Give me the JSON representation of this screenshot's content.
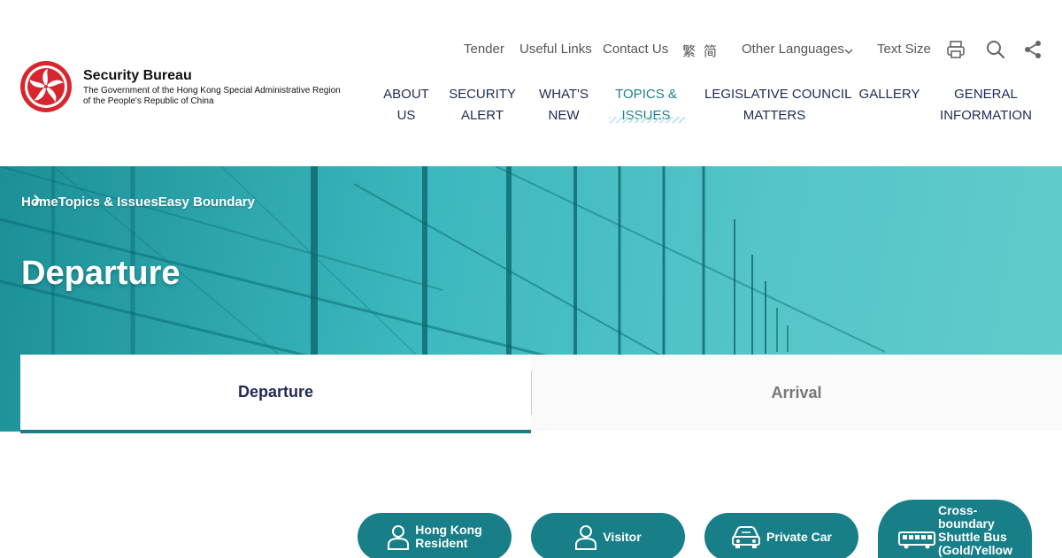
{
  "org": {
    "title": "Security Bureau",
    "subtitle_line1": "The Government of the Hong Kong Special Administrative Region",
    "subtitle_line2": "of the People's Republic of China"
  },
  "utility": {
    "tender": "Tender",
    "useful_links": "Useful Links",
    "contact_us": "Contact Us",
    "lang_tc": "繁",
    "lang_sc": "简",
    "other_languages": "Other Languages",
    "text_size": "Text Size",
    "icons": [
      "print-icon",
      "search-icon",
      "share-icon"
    ]
  },
  "nav": {
    "items": [
      {
        "line1": "ABOUT",
        "line2": "US"
      },
      {
        "line1": "SECURITY",
        "line2": "ALERT"
      },
      {
        "line1": "WHAT'S",
        "line2": "NEW"
      },
      {
        "line1": "TOPICS &",
        "line2": "ISSUES"
      },
      {
        "line1": "LEGISLATIVE COUNCIL",
        "line2": "MATTERS"
      },
      {
        "line1": "GALLERY",
        "line2": ""
      },
      {
        "line1": "GENERAL",
        "line2": "INFORMATION"
      }
    ],
    "active_index": 3
  },
  "breadcrumb": [
    "Home",
    "Topics & Issues",
    "Easy Boundary"
  ],
  "page_title": "Departure",
  "tabs": [
    "Departure",
    "Arrival"
  ],
  "categories": [
    {
      "line1": "Hong Kong",
      "line2": "Resident",
      "icon": "person-icon"
    },
    {
      "line1": "Visitor",
      "line2": "",
      "icon": "person-icon"
    },
    {
      "line1": "Private Car",
      "line2": "",
      "icon": "car-icon"
    },
    {
      "line1": "Cross-",
      "line2": "boundary",
      "line3": "Shuttle Bus",
      "line4": "(Gold/Yellow",
      "icon": "bus-icon"
    }
  ],
  "colors": {
    "primary": "#187f88",
    "nav_text": "#1f2a55",
    "active_nav": "#197f8a",
    "emblem_red": "#d7262e"
  }
}
